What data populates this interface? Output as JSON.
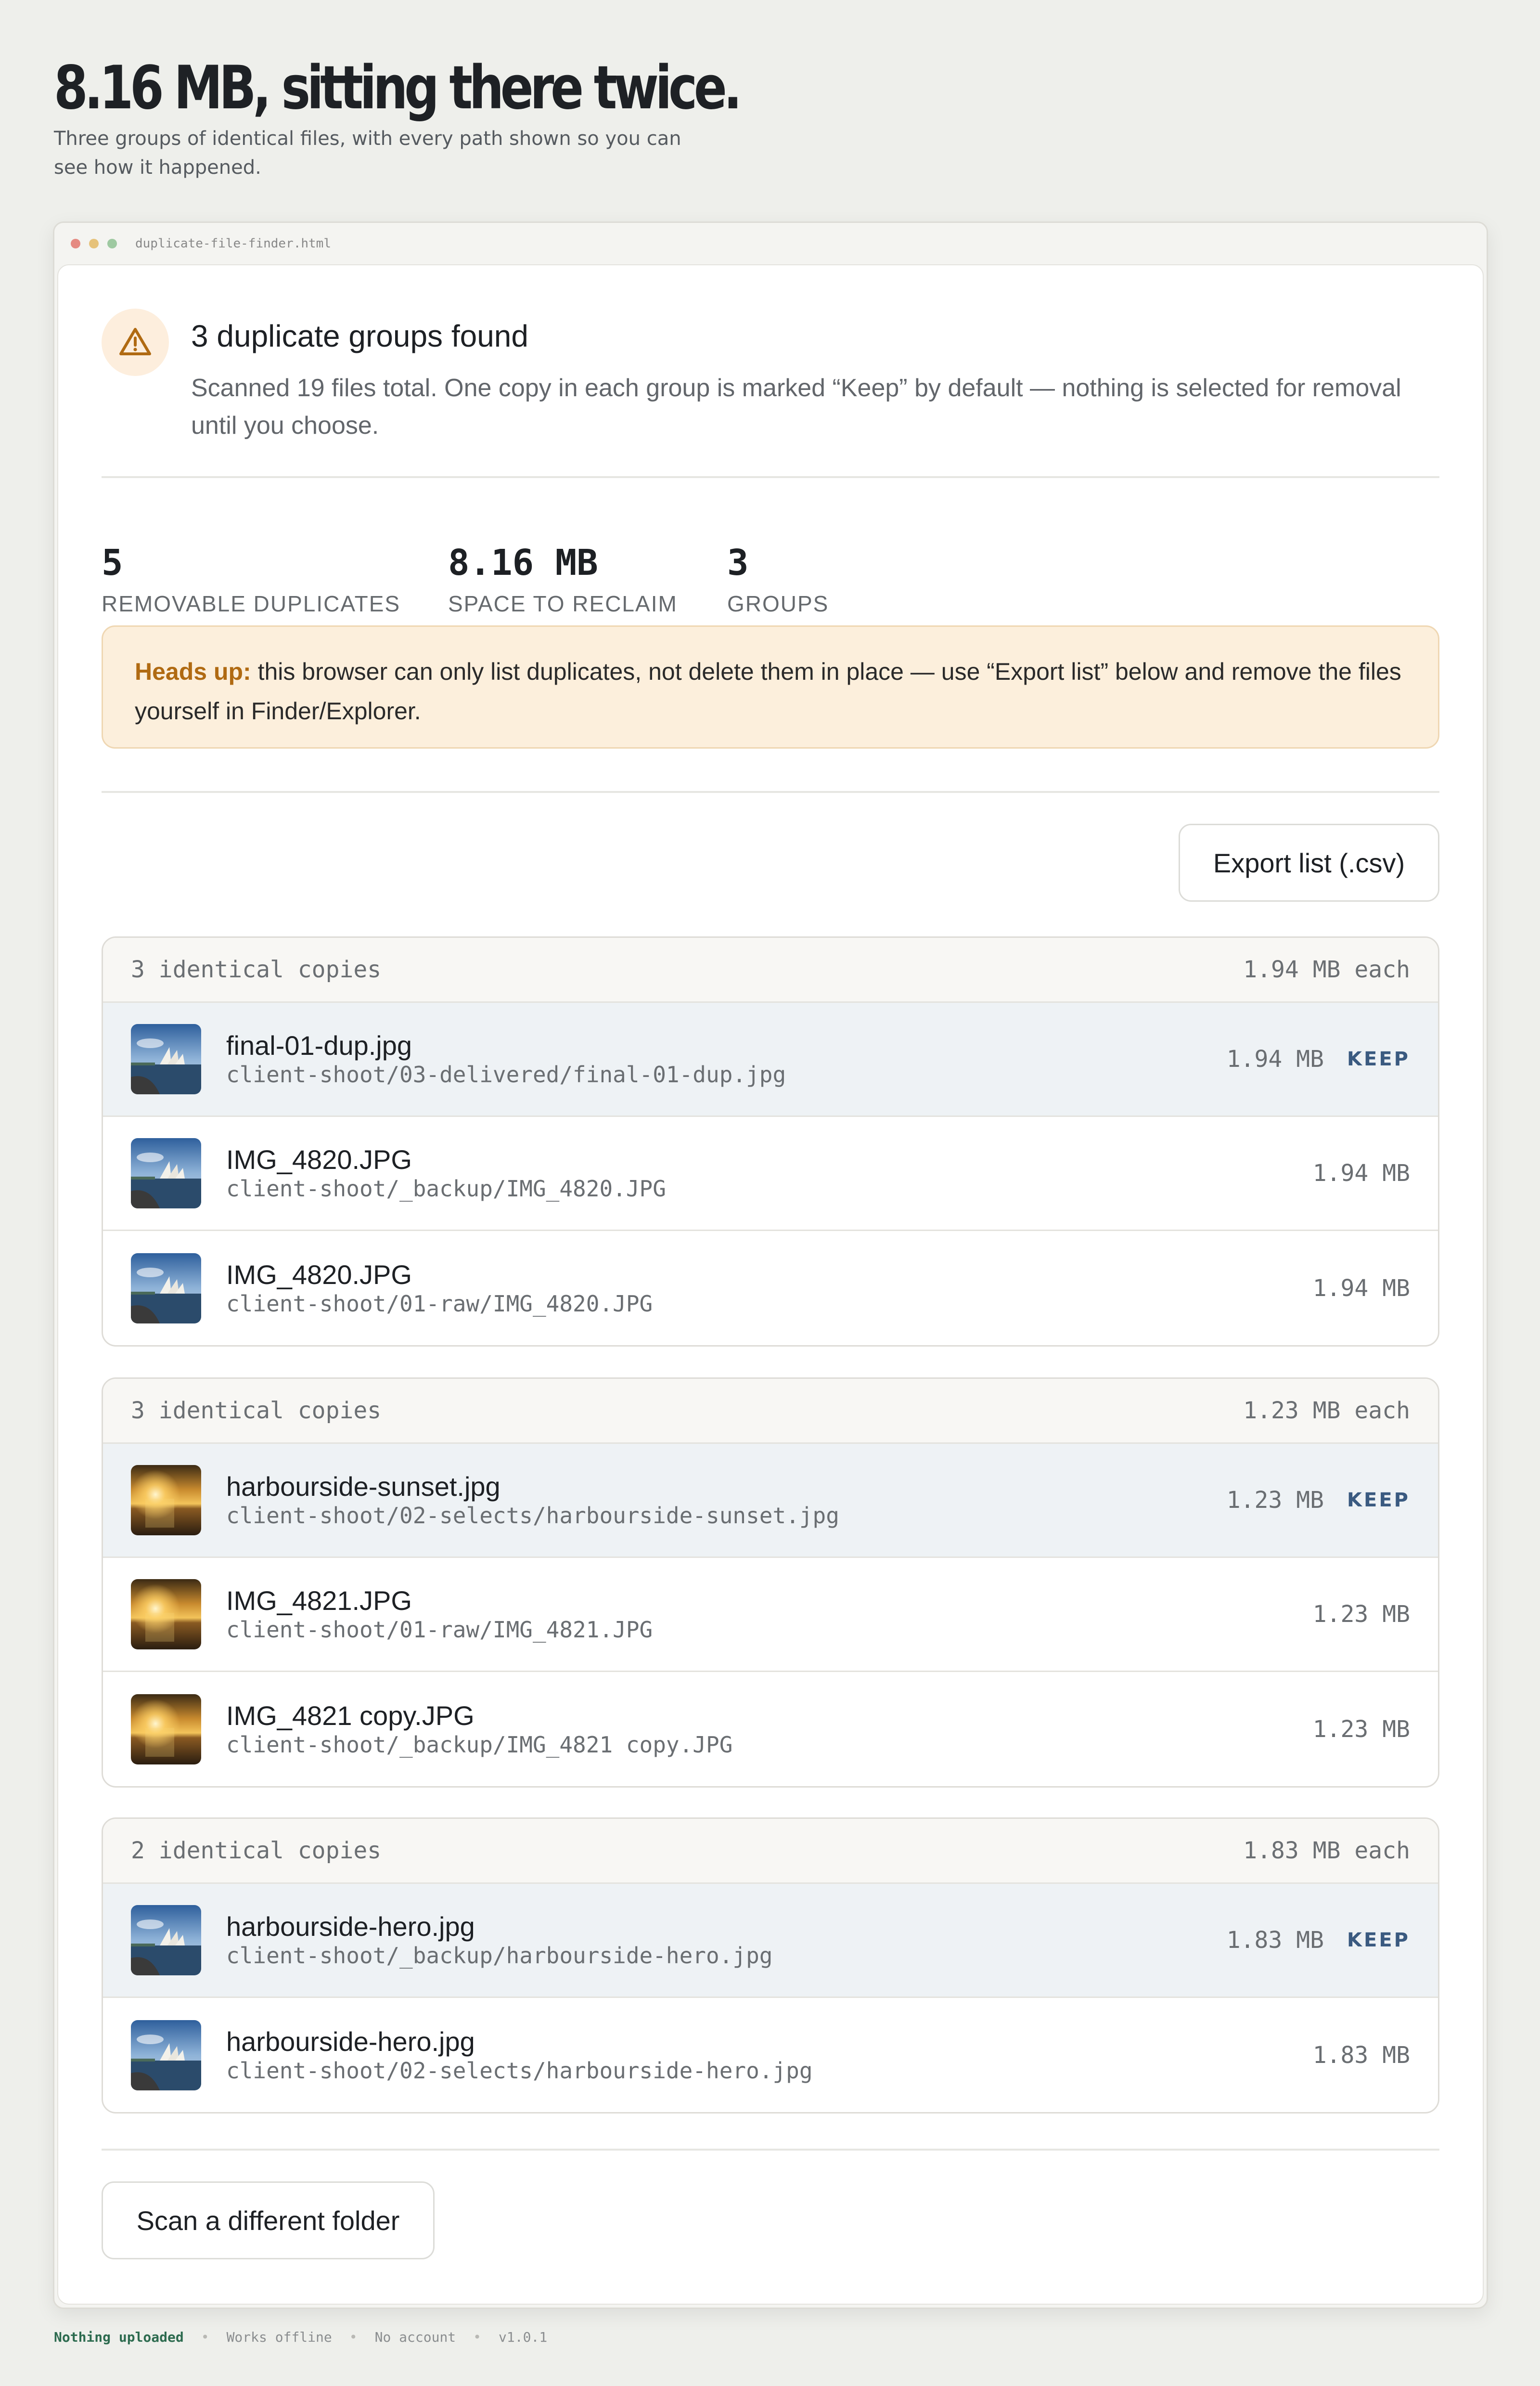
{
  "page": {
    "title": "8.16 MB, sitting there twice.",
    "subtitle": "Three groups of identical files, with every path shown so you can see how it happened."
  },
  "window": {
    "filename": "duplicate-file-finder.html",
    "dots": [
      "#e58a82",
      "#e6c27a",
      "#9ec9a1"
    ]
  },
  "alert": {
    "icon": "warning-triangle-icon",
    "title": "3 duplicate groups found",
    "description": "Scanned 19 files total. One copy in each group is marked “Keep” by default — nothing is selected for removal until you choose."
  },
  "stats": [
    {
      "value": "5",
      "label": "REMOVABLE DUPLICATES"
    },
    {
      "value": "8.16 MB",
      "label": "SPACE TO RECLAIM"
    },
    {
      "value": "3",
      "label": "GROUPS"
    }
  ],
  "notice": {
    "strong": "Heads up:",
    "text": "this browser can only list duplicates, not delete them in place — use “Export list” below and remove the files yourself in Finder/Explorer."
  },
  "actions": {
    "export_label": "Export list (.csv)",
    "rescan_label": "Scan a different folder"
  },
  "groups": [
    {
      "header": "3 identical copies",
      "each": "1.94 MB each",
      "files": [
        {
          "name": "final-01-dup.jpg",
          "path": "client-shoot/03-delivered/final-01-dup.jpg",
          "size": "1.94 MB",
          "keep": "KEEP",
          "thumb": "opera-house"
        },
        {
          "name": "IMG_4820.JPG",
          "path": "client-shoot/_backup/IMG_4820.JPG",
          "size": "1.94 MB",
          "keep": "",
          "thumb": "opera-house"
        },
        {
          "name": "IMG_4820.JPG",
          "path": "client-shoot/01-raw/IMG_4820.JPG",
          "size": "1.94 MB",
          "keep": "",
          "thumb": "opera-house"
        }
      ]
    },
    {
      "header": "3 identical copies",
      "each": "1.23 MB each",
      "files": [
        {
          "name": "harbourside-sunset.jpg",
          "path": "client-shoot/02-selects/harbourside-sunset.jpg",
          "size": "1.23 MB",
          "keep": "KEEP",
          "thumb": "sunset"
        },
        {
          "name": "IMG_4821.JPG",
          "path": "client-shoot/01-raw/IMG_4821.JPG",
          "size": "1.23 MB",
          "keep": "",
          "thumb": "sunset"
        },
        {
          "name": "IMG_4821 copy.JPG",
          "path": "client-shoot/_backup/IMG_4821 copy.JPG",
          "size": "1.23 MB",
          "keep": "",
          "thumb": "sunset"
        }
      ]
    },
    {
      "header": "2 identical copies",
      "each": "1.83 MB each",
      "files": [
        {
          "name": "harbourside-hero.jpg",
          "path": "client-shoot/_backup/harbourside-hero.jpg",
          "size": "1.83 MB",
          "keep": "KEEP",
          "thumb": "opera-house"
        },
        {
          "name": "harbourside-hero.jpg",
          "path": "client-shoot/02-selects/harbourside-hero.jpg",
          "size": "1.83 MB",
          "keep": "",
          "thumb": "opera-house"
        }
      ]
    }
  ],
  "footer": {
    "items": [
      "Nothing uploaded",
      "Works offline",
      "No account",
      "v1.0.1"
    ]
  }
}
